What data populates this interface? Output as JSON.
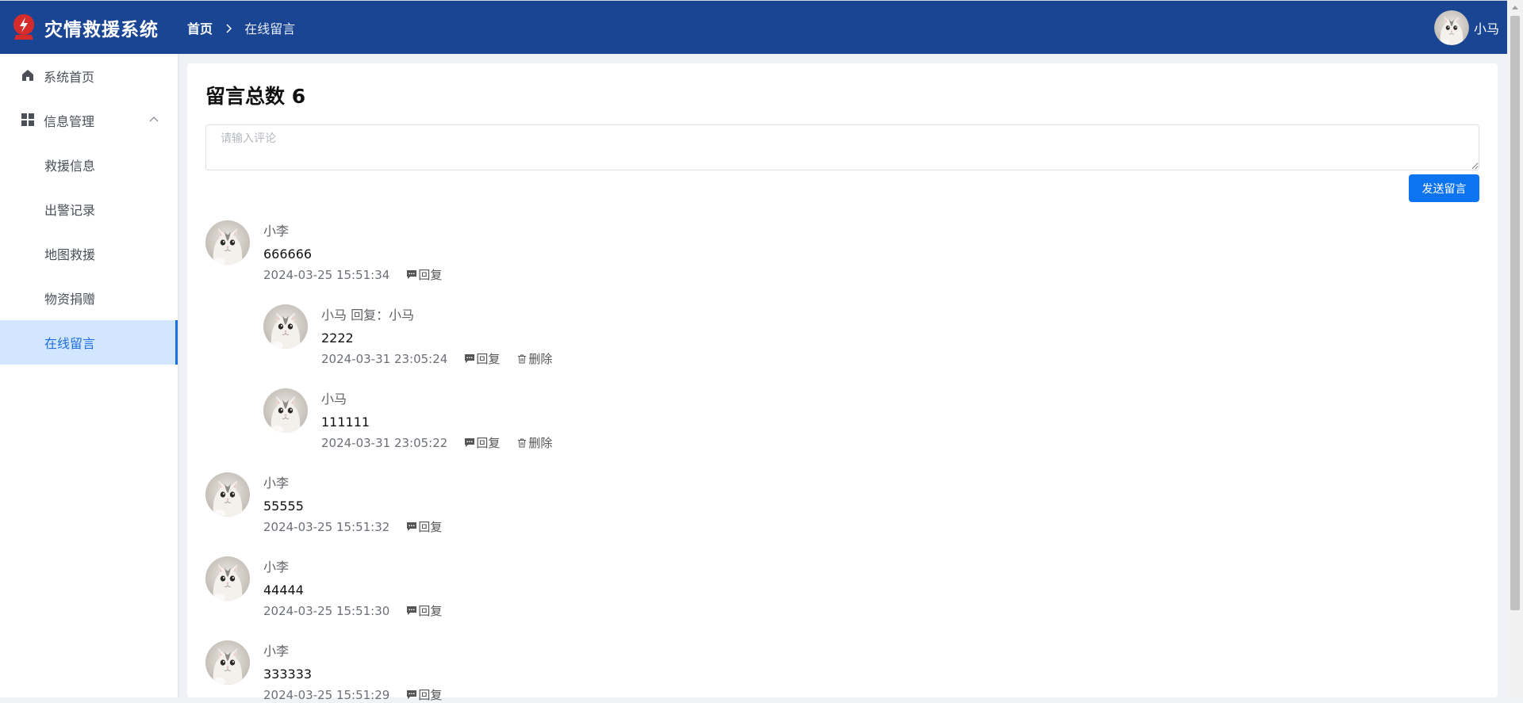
{
  "header": {
    "app_title": "灾情救援系统",
    "breadcrumb_home": "首页",
    "breadcrumb_current": "在线留言",
    "user_name": "小马"
  },
  "sidebar": {
    "items": [
      {
        "label": "系统首页",
        "icon": "home-icon"
      },
      {
        "label": "信息管理",
        "icon": "grid-icon",
        "expanded": true,
        "children": [
          {
            "label": "救援信息"
          },
          {
            "label": "出警记录"
          },
          {
            "label": "地图救援"
          },
          {
            "label": "物资捐赠"
          },
          {
            "label": "在线留言",
            "active": true
          }
        ]
      }
    ]
  },
  "main": {
    "title": "留言总数 6",
    "comment_placeholder": "请输入评论",
    "send_label": "发送留言",
    "reply_label": "回复",
    "delete_label": "删除",
    "comments": [
      {
        "name": "小李",
        "text": "666666",
        "time": "2024-03-25 15:51:34",
        "replies": [
          {
            "name": "小马 回复：小马",
            "text": "2222",
            "time": "2024-03-31 23:05:24",
            "deletable": true
          },
          {
            "name": "小马",
            "text": "111111",
            "time": "2024-03-31 23:05:22",
            "deletable": true
          }
        ]
      },
      {
        "name": "小李",
        "text": "55555",
        "time": "2024-03-25 15:51:32"
      },
      {
        "name": "小李",
        "text": "44444",
        "time": "2024-03-25 15:51:30"
      },
      {
        "name": "小李",
        "text": "333333",
        "time": "2024-03-25 15:51:29"
      }
    ]
  },
  "colors": {
    "header_bg": "#1a4593",
    "accent": "#0d74f0",
    "active_menu_bg": "#d3e6ff"
  }
}
